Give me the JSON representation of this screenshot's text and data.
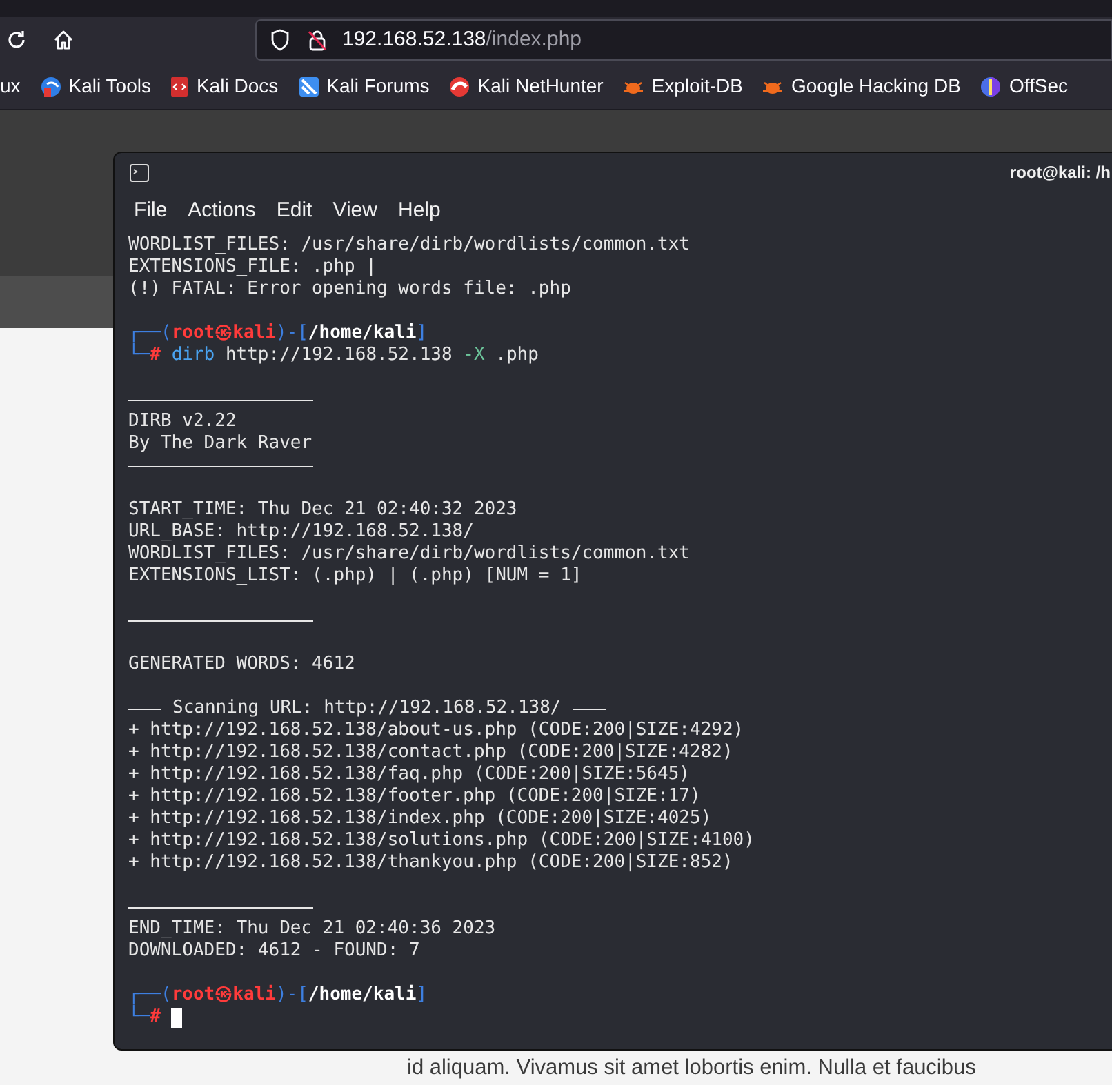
{
  "browser": {
    "url_host": "192.168.52.138",
    "url_path": "/index.php",
    "bookmarks": [
      {
        "label": "ux",
        "kind": "cut"
      },
      {
        "label": "Kali Tools",
        "kind": "tools"
      },
      {
        "label": "Kali Docs",
        "kind": "docs"
      },
      {
        "label": "Kali Forums",
        "kind": "forums"
      },
      {
        "label": "Kali NetHunter",
        "kind": "nethunter"
      },
      {
        "label": "Exploit-DB",
        "kind": "bug"
      },
      {
        "label": "Google Hacking DB",
        "kind": "bug"
      },
      {
        "label": "OffSec",
        "kind": "offsec"
      }
    ]
  },
  "website": {
    "visible_line": "id aliquam. Vivamus sit amet lobortis enim. Nulla et faucibus"
  },
  "terminal": {
    "title": "root@kali: /h",
    "menu": [
      "File",
      "Actions",
      "Edit",
      "View",
      "Help"
    ],
    "lines": [
      {
        "kind": "text",
        "text": "WORDLIST_FILES: /usr/share/dirb/wordlists/common.txt"
      },
      {
        "kind": "text",
        "text": "EXTENSIONS_FILE: .php |"
      },
      {
        "kind": "text",
        "text": "(!) FATAL: Error opening words file: .php"
      },
      {
        "kind": "blank"
      },
      {
        "kind": "prompt",
        "corner": "┌──(",
        "user": "root",
        "at": "㉿",
        "host": "kali",
        "mid": ")-[",
        "path": "/home/kali",
        "end": "]"
      },
      {
        "kind": "command",
        "corner": "└─",
        "mark": "#",
        "program": "dirb",
        "args": "http://192.168.52.138",
        "flag": "-X",
        "value": ".php"
      },
      {
        "kind": "blank"
      },
      {
        "kind": "rule"
      },
      {
        "kind": "text",
        "text": "DIRB v2.22"
      },
      {
        "kind": "text",
        "text": "By The Dark Raver"
      },
      {
        "kind": "rule"
      },
      {
        "kind": "blank"
      },
      {
        "kind": "text",
        "text": "START_TIME: Thu Dec 21 02:40:32 2023"
      },
      {
        "kind": "text",
        "text": "URL_BASE: http://192.168.52.138/"
      },
      {
        "kind": "text",
        "text": "WORDLIST_FILES: /usr/share/dirb/wordlists/common.txt"
      },
      {
        "kind": "text",
        "text": "EXTENSIONS_LIST: (.php) | (.php) [NUM = 1]"
      },
      {
        "kind": "blank"
      },
      {
        "kind": "rule"
      },
      {
        "kind": "blank"
      },
      {
        "kind": "text",
        "text": "GENERATED WORDS: 4612"
      },
      {
        "kind": "blank"
      },
      {
        "kind": "banner",
        "text": "Scanning URL: http://192.168.52.138/"
      },
      {
        "kind": "text",
        "text": "+ http://192.168.52.138/about-us.php (CODE:200|SIZE:4292)"
      },
      {
        "kind": "text",
        "text": "+ http://192.168.52.138/contact.php (CODE:200|SIZE:4282)"
      },
      {
        "kind": "text",
        "text": "+ http://192.168.52.138/faq.php (CODE:200|SIZE:5645)"
      },
      {
        "kind": "text",
        "text": "+ http://192.168.52.138/footer.php (CODE:200|SIZE:17)"
      },
      {
        "kind": "text",
        "text": "+ http://192.168.52.138/index.php (CODE:200|SIZE:4025)"
      },
      {
        "kind": "text",
        "text": "+ http://192.168.52.138/solutions.php (CODE:200|SIZE:4100)"
      },
      {
        "kind": "text",
        "text": "+ http://192.168.52.138/thankyou.php (CODE:200|SIZE:852)"
      },
      {
        "kind": "blank"
      },
      {
        "kind": "rule"
      },
      {
        "kind": "text",
        "text": "END_TIME: Thu Dec 21 02:40:36 2023"
      },
      {
        "kind": "text",
        "text": "DOWNLOADED: 4612 - FOUND: 7"
      },
      {
        "kind": "blank"
      },
      {
        "kind": "prompt",
        "corner": "┌──(",
        "user": "root",
        "at": "㉿",
        "host": "kali",
        "mid": ")-[",
        "path": "/home/kali",
        "end": "]"
      },
      {
        "kind": "input",
        "corner": "└─",
        "mark": "#"
      }
    ]
  }
}
